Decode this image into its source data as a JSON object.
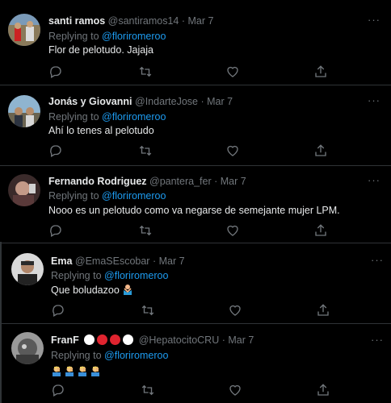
{
  "tweets": [
    {
      "name": "santi ramos",
      "handle": "@santiramos14",
      "date": "Mar 7",
      "replying_prefix": "Replying to",
      "replying_to": "@floriromeroo",
      "text": "Flor de pelotudo. Jajaja",
      "more": "···"
    },
    {
      "name": "Jonás y Giovanni",
      "handle": "@IndarteJose",
      "date": "Mar 7",
      "replying_prefix": "Replying to",
      "replying_to": "@floriromeroo",
      "text": "Ahí lo tenes al pelotudo",
      "more": "···"
    },
    {
      "name": "Fernando Rodriguez",
      "handle": "@pantera_fer",
      "date": "Mar 7",
      "replying_prefix": "Replying to",
      "replying_to": "@floriromeroo",
      "text": "Nooo es un pelotudo como va negarse de semejante mujer LPM.",
      "more": "···"
    },
    {
      "name": "Ema",
      "handle": "@EmaSEscobar",
      "date": "Mar 7",
      "replying_prefix": "Replying to",
      "replying_to": "@floriromeroo",
      "text": "Que boludazoo",
      "more": "···"
    },
    {
      "name": "FranF",
      "handle": "@HepatocitoCRU",
      "date": "Mar 7",
      "replying_prefix": "Replying to",
      "replying_to": "@floriromeroo",
      "text": "",
      "more": "···"
    }
  ],
  "separator": " · ",
  "colors": {
    "background": "#000000",
    "link": "#1d9bf0",
    "muted": "#71767b",
    "text": "#e7e9ea",
    "border": "#2f3336"
  },
  "icons": [
    "reply-icon",
    "retweet-icon",
    "like-icon",
    "share-icon",
    "more-icon",
    "man-facepalming-emoji",
    "person-gesturing-no-emoji"
  ]
}
